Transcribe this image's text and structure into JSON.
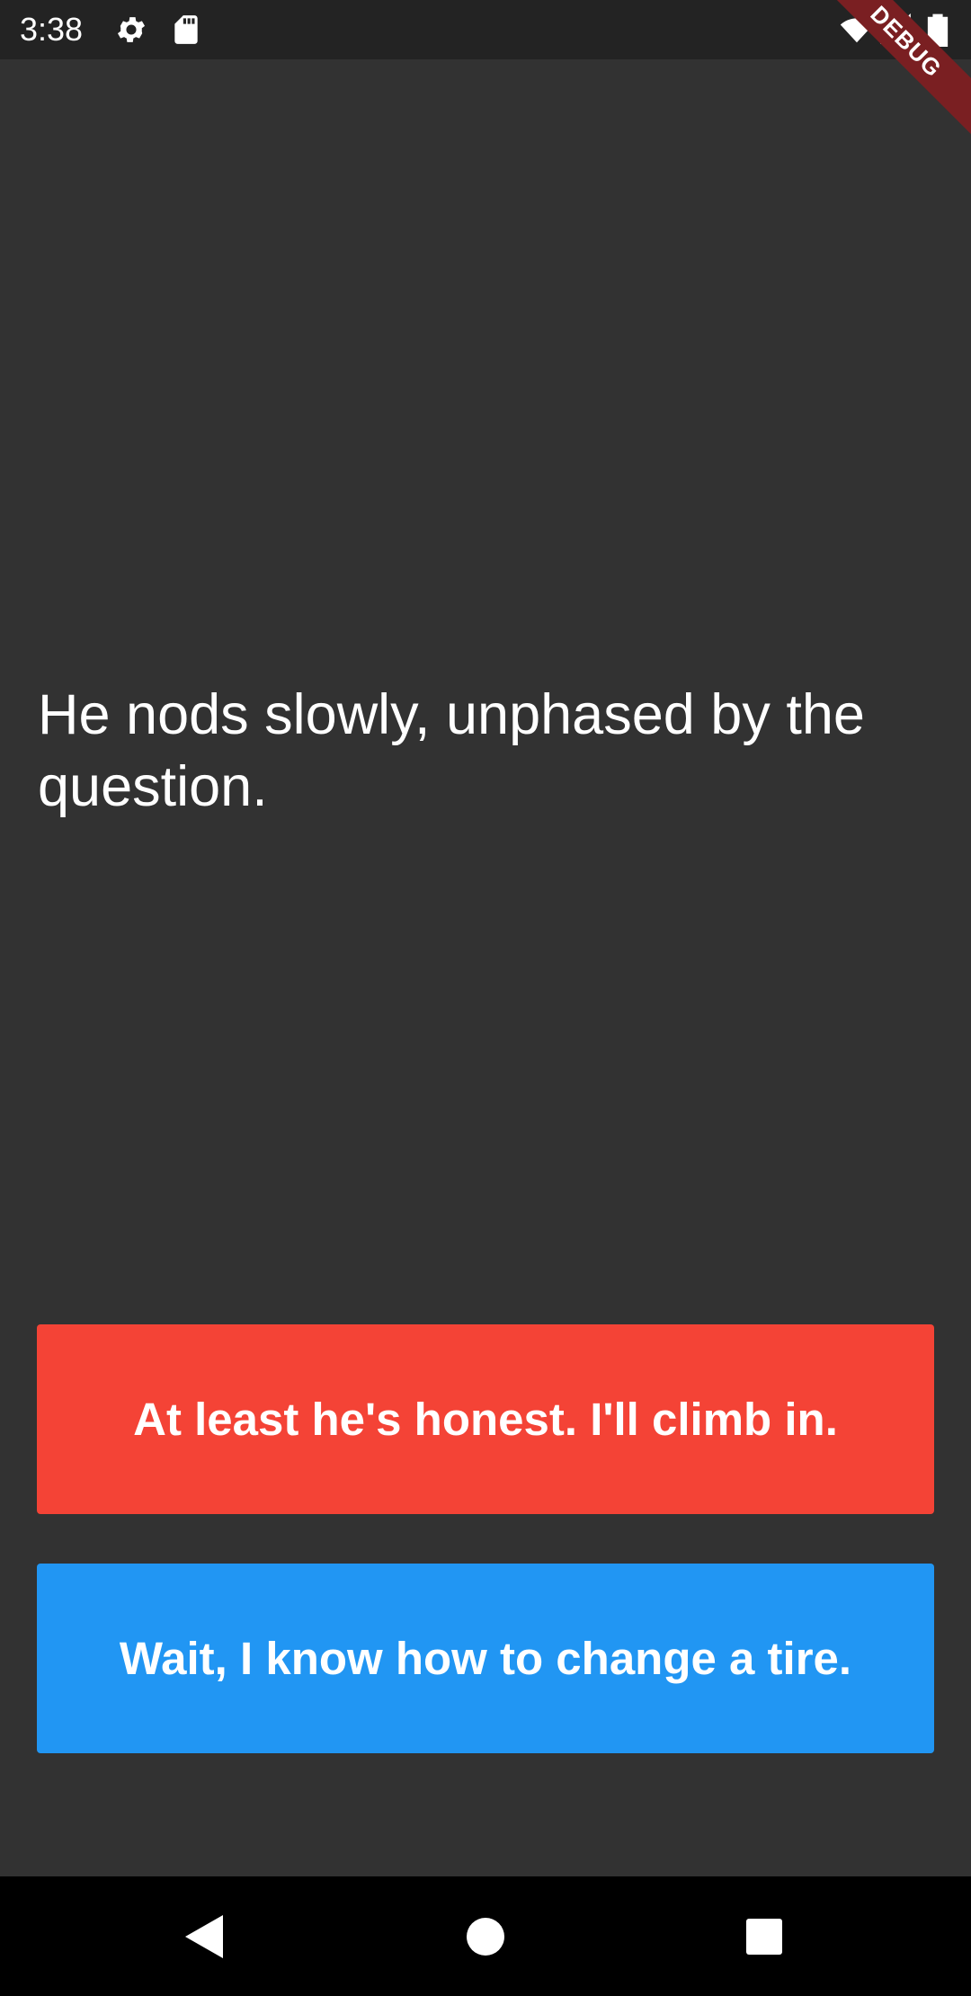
{
  "status_bar": {
    "time": "3:38",
    "icons": [
      "gear-icon",
      "sd-card-icon",
      "wifi-icon",
      "cell-signal-icon",
      "battery-icon"
    ]
  },
  "debug_banner": {
    "label": "DEBUG",
    "color": "#7a1f22"
  },
  "story": {
    "text": "He nods slowly, unphased by the question."
  },
  "choices": [
    {
      "label": "At least he's honest. I'll climb in.",
      "color": "#f44336"
    },
    {
      "label": "Wait, I know how to change a tire.",
      "color": "#2196f3"
    }
  ],
  "nav_bar": {
    "icons": [
      "back-icon",
      "home-icon",
      "recents-icon"
    ]
  },
  "colors": {
    "background": "#323232",
    "status_bar": "#232323",
    "nav_bar": "#000000",
    "text": "#ffffff"
  }
}
